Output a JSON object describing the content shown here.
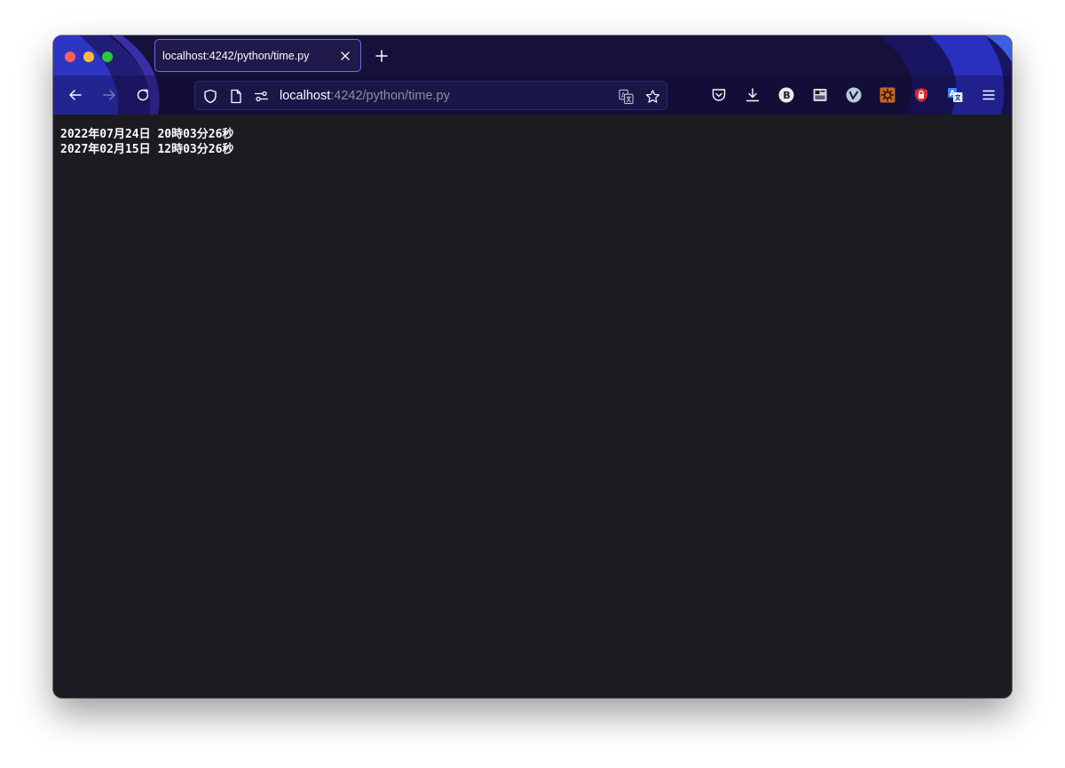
{
  "browser": {
    "tab": {
      "title": "localhost:4242/python/time.py",
      "close_icon": "close-icon"
    },
    "new_tab_icon": "plus-icon",
    "nav": {
      "back_icon": "arrow-left-icon",
      "forward_icon": "arrow-right-icon",
      "reload_icon": "reload-icon"
    },
    "urlbar": {
      "host": "localhost",
      "path": ":4242/python/time.py",
      "shield_icon": "shield-icon",
      "page_icon": "page-icon",
      "permissions_icon": "permissions-icon",
      "translate_icon": "translate-icon",
      "bookmark_icon": "star-icon"
    },
    "toolbar_icons": [
      "pocket-icon",
      "download-icon",
      "extension-b-icon",
      "extension-screenshot-icon",
      "extension-v-icon",
      "extension-gear-icon",
      "extension-lock-icon",
      "extension-translate-icon",
      "menu-icon"
    ],
    "extension_b_letter": "B"
  },
  "page": {
    "lines": [
      "2022年07月24日 20時03分26秒",
      "2027年02月15日 12時03分26秒"
    ]
  },
  "colors": {
    "chrome": "#14113a",
    "content_bg": "#1c1b22",
    "accent": "#6b6cf0",
    "text": "#fbfbfe"
  }
}
